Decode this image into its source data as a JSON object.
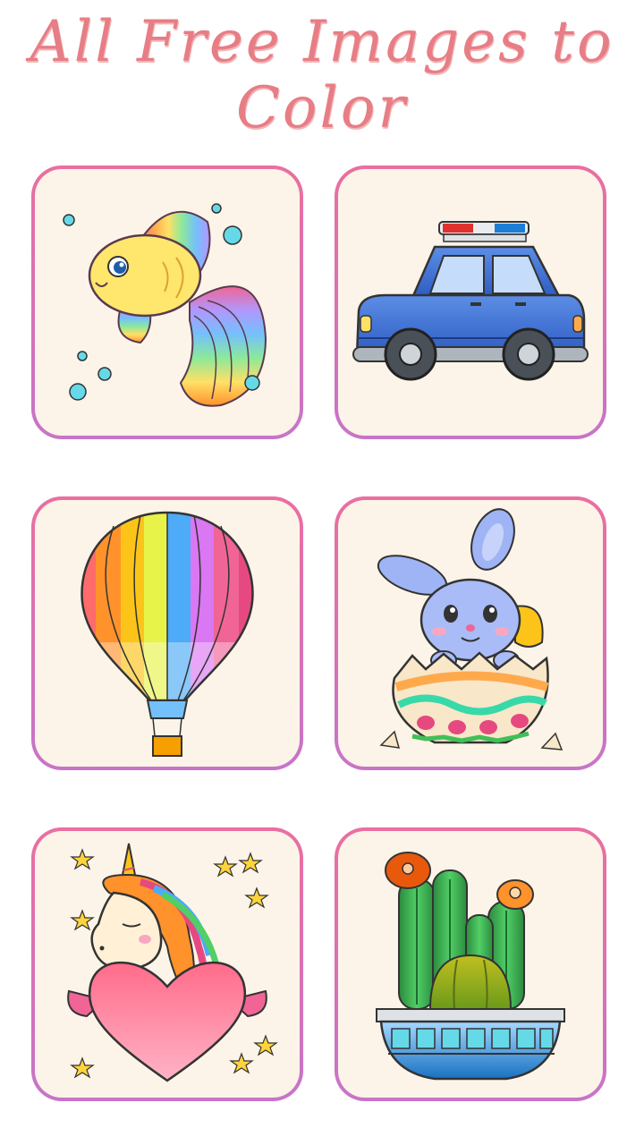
{
  "header": {
    "title": "All Free Images to Color"
  },
  "gallery": {
    "items": [
      {
        "id": "fish",
        "icon": "rainbow-fish-icon"
      },
      {
        "id": "police-car",
        "icon": "police-car-icon"
      },
      {
        "id": "hot-air-balloon",
        "icon": "hot-air-balloon-icon"
      },
      {
        "id": "bunny-egg",
        "icon": "bunny-in-egg-icon"
      },
      {
        "id": "unicorn-heart",
        "icon": "unicorn-heart-icon"
      },
      {
        "id": "cactus-pot",
        "icon": "cactus-pot-icon"
      }
    ]
  },
  "colors": {
    "title": "#e77d85",
    "card_border_top": "#ea6fa0",
    "card_border_bottom": "#c774c9",
    "card_fill": "#fcf4e8"
  }
}
